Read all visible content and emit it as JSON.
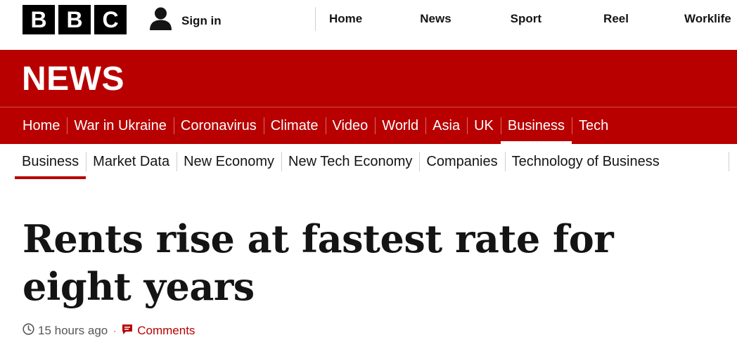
{
  "logo": {
    "letters": [
      "B",
      "B",
      "C"
    ]
  },
  "account": {
    "signin_label": "Sign in",
    "icon": "user-icon"
  },
  "top_nav": [
    "Home",
    "News",
    "Sport",
    "Reel",
    "Worklife"
  ],
  "section_logo": "NEWS",
  "section_nav": [
    {
      "label": "Home"
    },
    {
      "label": "War in Ukraine"
    },
    {
      "label": "Coronavirus"
    },
    {
      "label": "Climate"
    },
    {
      "label": "Video"
    },
    {
      "label": "World"
    },
    {
      "label": "Asia"
    },
    {
      "label": "UK"
    },
    {
      "label": "Business",
      "active": true
    },
    {
      "label": "Tech"
    }
  ],
  "sub_nav": [
    {
      "label": "Business",
      "active": true
    },
    {
      "label": "Market Data"
    },
    {
      "label": "New Economy"
    },
    {
      "label": "New Tech Economy"
    },
    {
      "label": "Companies"
    },
    {
      "label": "Technology of Business"
    }
  ],
  "article": {
    "headline": "Rents rise at fastest rate for eight years",
    "timestamp": "15 hours ago",
    "comments_label": "Comments"
  },
  "colors": {
    "brand_red": "#b80000",
    "text": "#141414",
    "meta_grey": "#545658"
  }
}
